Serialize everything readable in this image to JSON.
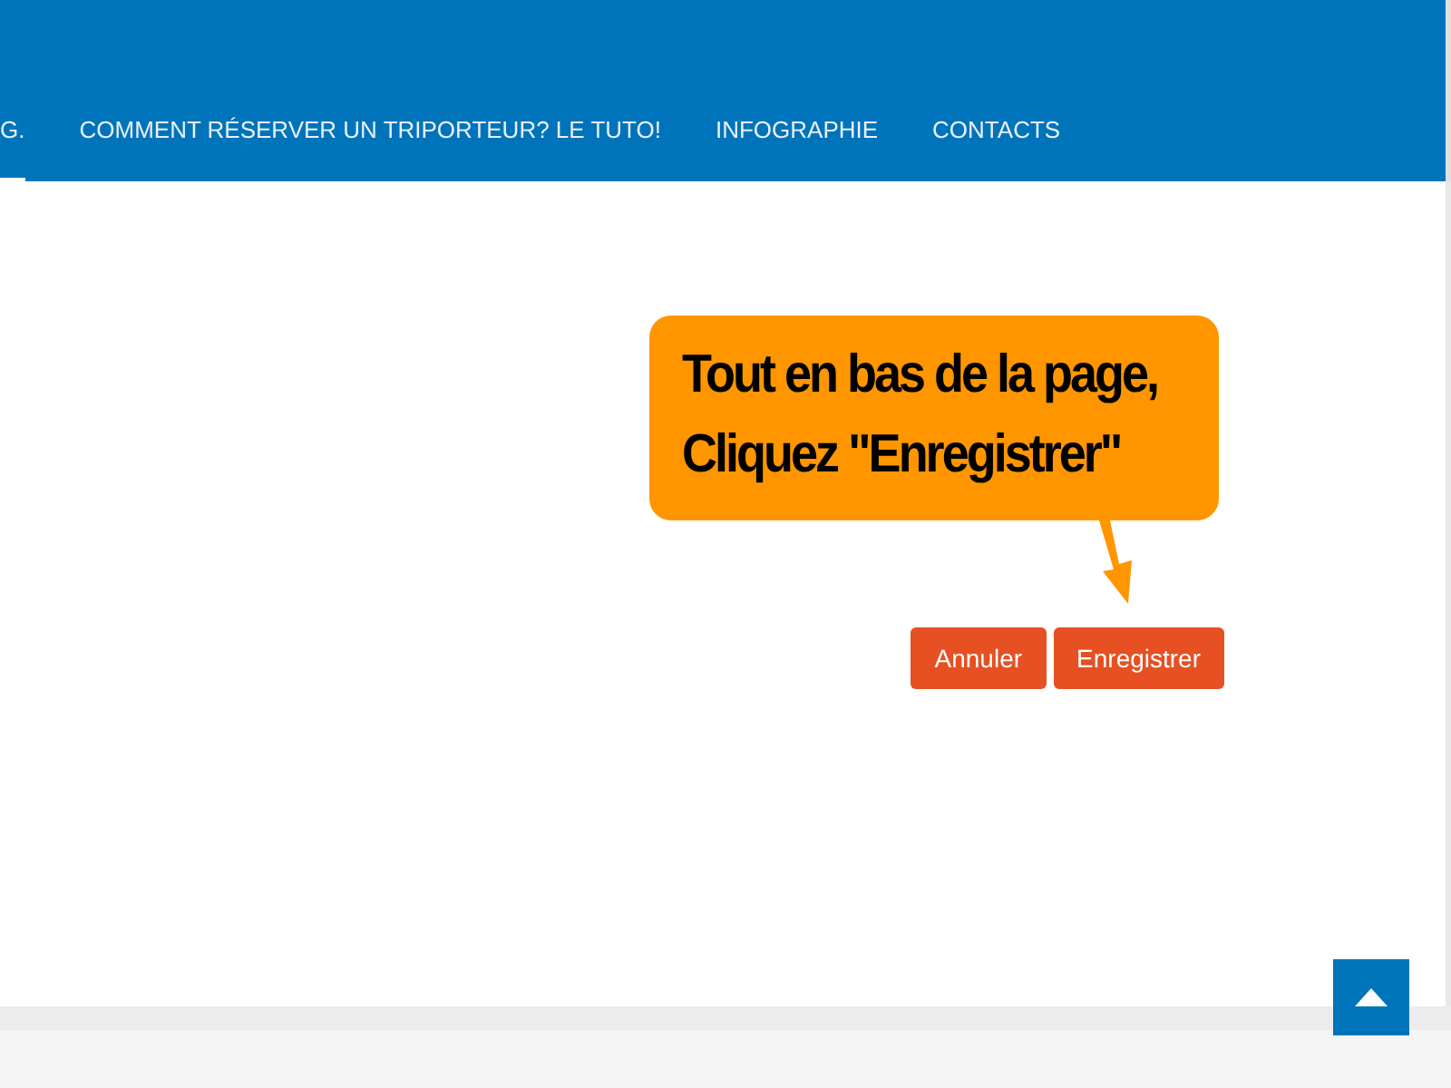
{
  "nav": {
    "items": [
      {
        "label": "G.",
        "selected": true
      },
      {
        "label": "COMMENT RÉSERVER UN TRIPORTEUR? LE TUTO!",
        "selected": false
      },
      {
        "label": "INFOGRAPHIE",
        "selected": false
      },
      {
        "label": "CONTACTS",
        "selected": false
      }
    ]
  },
  "callout": {
    "lines": [
      "Tout en bas de la page,",
      "Cliquez \"Enregistrer\""
    ]
  },
  "buttons": [
    "Annuler",
    "Enregistrer"
  ]
}
